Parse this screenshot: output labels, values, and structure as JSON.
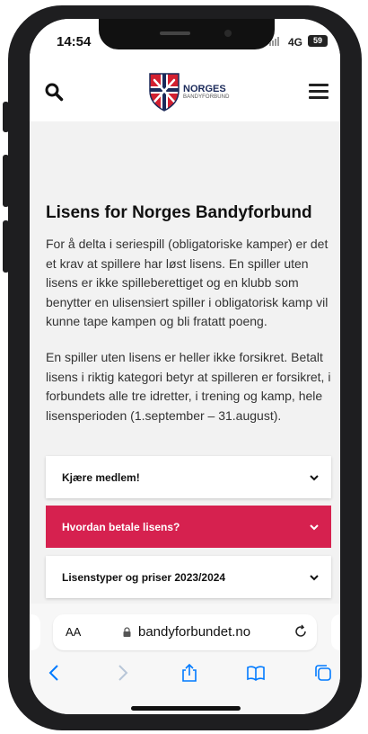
{
  "status_bar": {
    "time": "14:54",
    "network": "4G",
    "battery": "59"
  },
  "header": {
    "logo_line1": "NORGES",
    "logo_line2": "BANDYFORBUND",
    "icons": [
      "search-icon",
      "norges-bandyforbund-logo",
      "hamburger-menu-icon"
    ]
  },
  "main": {
    "title": "Lisens for Norges Bandyforbund",
    "paragraph1": "For å delta i seriespill (obligatoriske kamper) er det et krav at spillere har løst lisens. En spiller uten lisens er ikke spilleberettiget og en klubb som benytter en ulisensiert spiller i obligatorisk kamp vil kunne tape kampen og bli fratatt poeng.",
    "paragraph2": "En spiller uten lisens er heller ikke forsikret. Betalt lisens i riktig kategori betyr at spilleren er forsikret, i forbundets alle tre idretter, i trening og kamp, hele lisensperioden (1.september – 31.august).",
    "accordions": [
      {
        "label": "Kjære medlem!"
      },
      {
        "label": "Hvordan betale lisens?"
      },
      {
        "label": "Lisenstyper og priser 2023/2024"
      }
    ]
  },
  "browser": {
    "text_size_label": "AA",
    "url": "bandyforbundet.no",
    "toolbar_icons": [
      "back-icon",
      "forward-icon",
      "share-icon",
      "bookmarks-icon",
      "tabs-icon"
    ]
  },
  "colors": {
    "accent": "#d6214f",
    "brand_navy": "#1b2a5a",
    "ios_blue": "#007aff",
    "page_bg": "#f2f2f2"
  }
}
